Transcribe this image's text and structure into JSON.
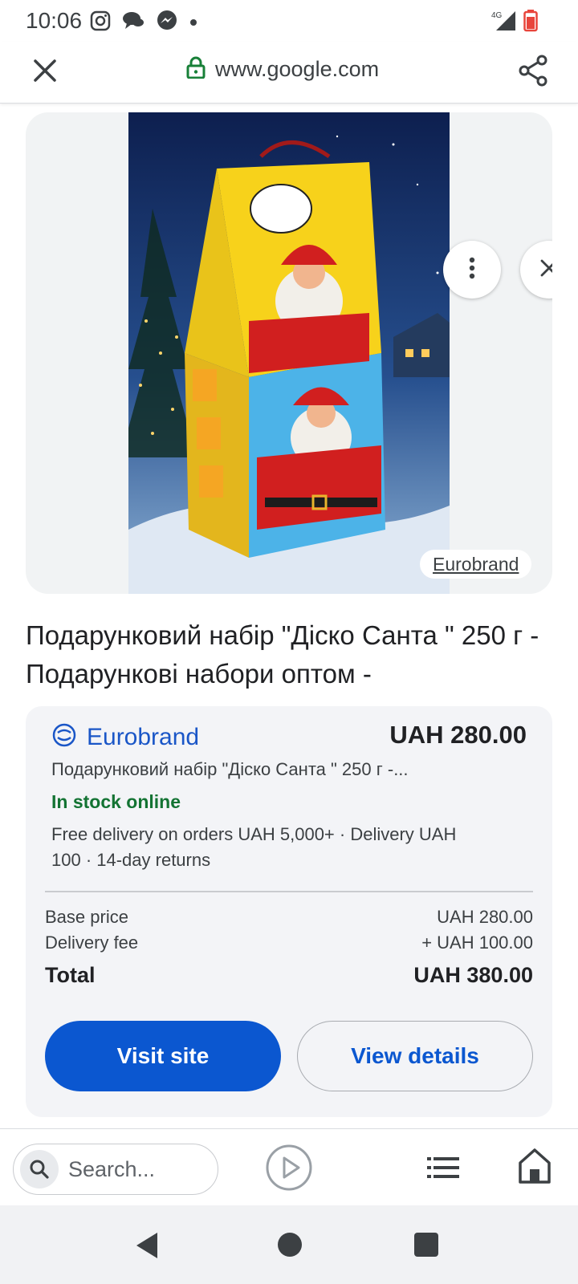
{
  "status_bar": {
    "time": "10:06",
    "network": "4G"
  },
  "browser": {
    "url": "www.google.com"
  },
  "image": {
    "source_label": "Eurobrand"
  },
  "product": {
    "title": "Подарунковий набір \"Діско Санта \" 250 г - Подарункові набори оптом -"
  },
  "offer": {
    "merchant": "Eurobrand",
    "price": "UAH 280.00",
    "description": "Подарунковий набір \"Діско Санта \" 250 г -...",
    "stock": "In stock online",
    "shipping": "Free delivery on orders UAH 5,000+ · Delivery UAH 100 · 14-day returns",
    "base_price_label": "Base price",
    "base_price_value": "UAH 280.00",
    "delivery_fee_label": "Delivery fee",
    "delivery_fee_value": "+ UAH 100.00",
    "total_label": "Total",
    "total_value": "UAH 380.00",
    "visit_site_label": "Visit site",
    "view_details_label": "View details"
  },
  "toolbar": {
    "search_placeholder": "Search..."
  },
  "colors": {
    "accent": "#0b57d0",
    "merchant": "#1a56c7",
    "stock": "#137333",
    "card_bg": "#f3f4f7"
  }
}
